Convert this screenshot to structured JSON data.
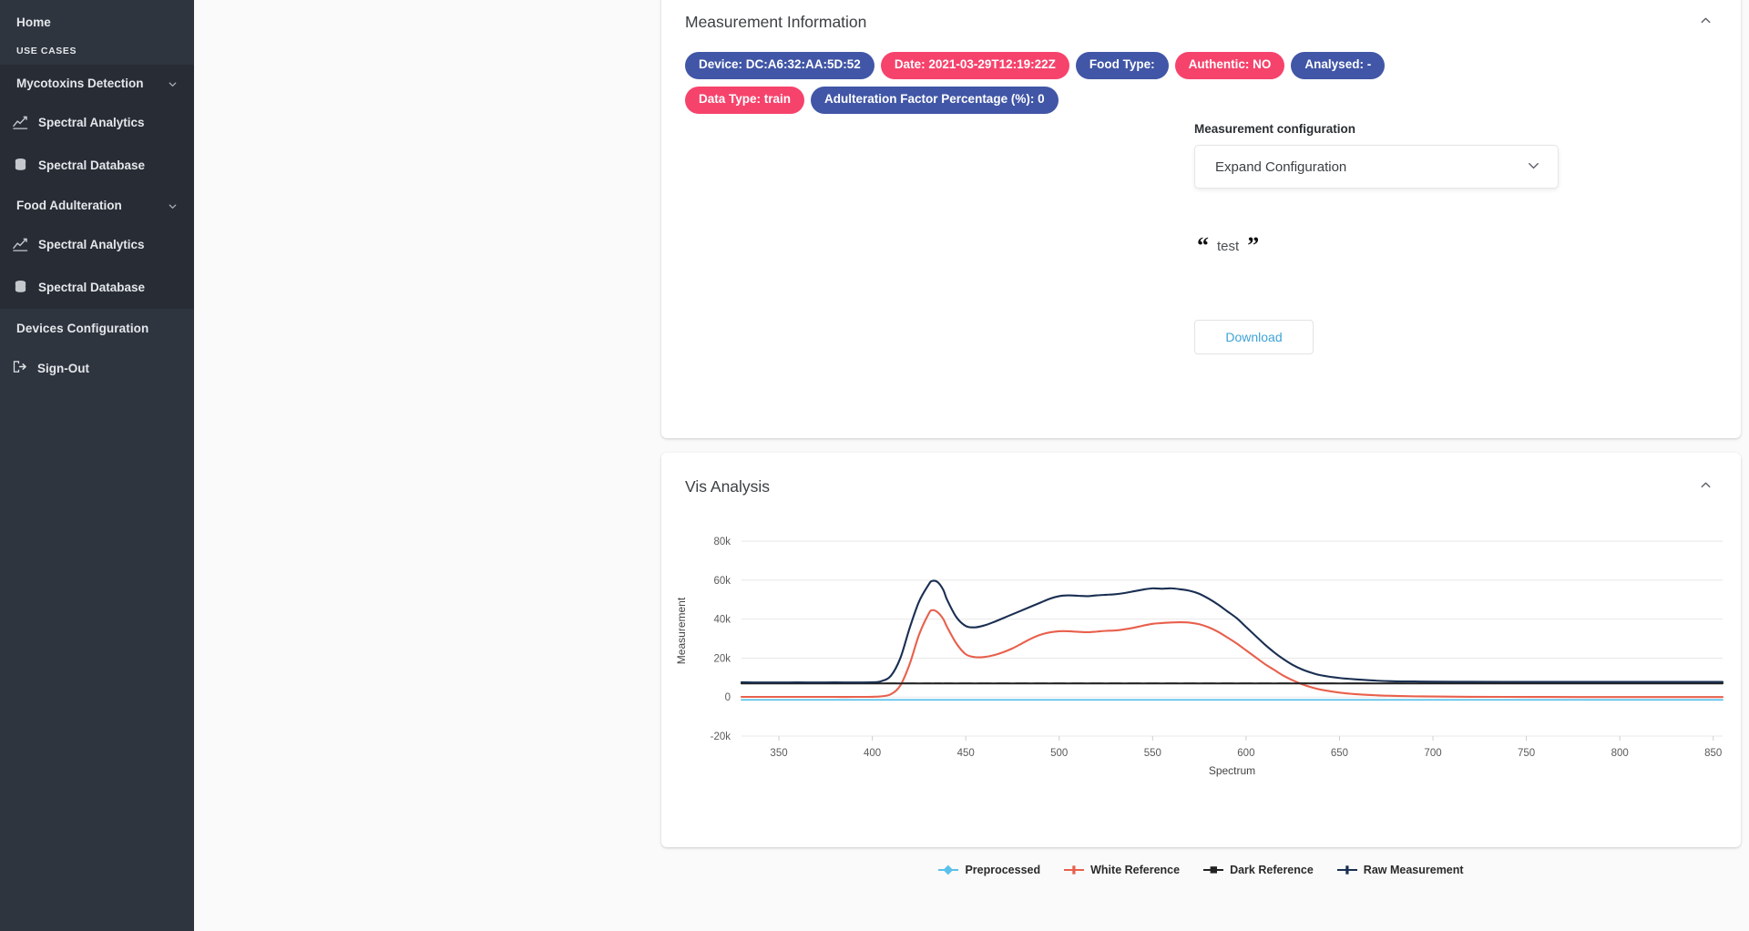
{
  "sidebar": {
    "home_label": "Home",
    "section_caption": "USE CASES",
    "groups": [
      {
        "label": "Mycotoxins Detection",
        "items": [
          {
            "label": "Spectral Analytics",
            "icon": "chart-line-icon"
          },
          {
            "label": "Spectral Database",
            "icon": "database-icon"
          }
        ]
      },
      {
        "label": "Food Adulteration",
        "items": [
          {
            "label": "Spectral Analytics",
            "icon": "chart-line-icon"
          },
          {
            "label": "Spectral Database",
            "icon": "database-icon"
          }
        ]
      }
    ],
    "devices_label": "Devices Configuration",
    "signout_label": "Sign-Out",
    "signout_icon": "sign-out-icon"
  },
  "measurement_card": {
    "title": "Measurement Information",
    "collapse_icon": "chevron-up-icon",
    "badges": [
      {
        "label": "Device: DC:A6:32:AA:5D:52",
        "color": "#4156a6",
        "variant": "primary"
      },
      {
        "label": "Date: 2021-03-29T12:19:22Z",
        "color": "#f6436c",
        "variant": "danger"
      },
      {
        "label": "Food Type:",
        "color": "#4156a6",
        "variant": "primary"
      },
      {
        "label": "Authentic: NO",
        "color": "#f6436c",
        "variant": "danger"
      },
      {
        "label": "Analysed: -",
        "color": "#4156a6",
        "variant": "primary"
      },
      {
        "label": "Data Type: train",
        "color": "#f6436c",
        "variant": "danger"
      },
      {
        "label": "Adulteration Factor Percentage (%): 0",
        "color": "#4156a6",
        "variant": "primary"
      }
    ],
    "config_label": "Measurement configuration",
    "config_value": "Expand Configuration",
    "config_chevron_icon": "chevron-down-icon",
    "quote_text": "test",
    "quote_open": "“",
    "quote_close": "”",
    "download_label": "Download"
  },
  "vis_card": {
    "title": "Vis Analysis",
    "collapse_icon": "chevron-up-icon"
  },
  "chart_data": {
    "type": "line",
    "title": "Vis Analysis",
    "xlabel": "Spectrum",
    "ylabel": "Measurement",
    "xlim": [
      330,
      855
    ],
    "ylim": [
      -20000,
      88000
    ],
    "xticks": [
      350,
      400,
      450,
      500,
      550,
      600,
      650,
      700,
      750,
      800,
      850
    ],
    "yticks": [
      -20000,
      0,
      20000,
      40000,
      60000,
      80000
    ],
    "ytick_labels": [
      "-20k",
      "0",
      "20k",
      "40k",
      "60k",
      "80k"
    ],
    "grid": true,
    "legend_position": "bottom",
    "x": [
      330,
      340,
      350,
      360,
      370,
      380,
      390,
      400,
      405,
      410,
      415,
      420,
      425,
      430,
      432,
      435,
      438,
      440,
      445,
      450,
      455,
      460,
      465,
      470,
      475,
      480,
      485,
      490,
      495,
      500,
      505,
      510,
      515,
      520,
      525,
      530,
      535,
      540,
      545,
      550,
      555,
      560,
      565,
      570,
      575,
      580,
      585,
      590,
      595,
      600,
      605,
      610,
      615,
      620,
      625,
      630,
      635,
      640,
      650,
      660,
      670,
      680,
      690,
      700,
      720,
      740,
      760,
      780,
      800,
      820,
      840,
      855
    ],
    "series": [
      {
        "name": "Raw Measurement",
        "color": "#1a2f52",
        "marker": "plus",
        "values": [
          7600,
          7500,
          7500,
          7550,
          7500,
          7550,
          7500,
          7600,
          8200,
          11000,
          20000,
          35500,
          49000,
          57500,
          59600,
          59000,
          55000,
          50000,
          41000,
          36500,
          35800,
          36800,
          38500,
          40500,
          42500,
          44500,
          46500,
          48500,
          50500,
          51800,
          52200,
          52000,
          51800,
          52200,
          52500,
          52800,
          53400,
          54300,
          55200,
          55800,
          55600,
          55800,
          55300,
          54500,
          53000,
          50500,
          47500,
          44000,
          40500,
          36000,
          31500,
          27000,
          23000,
          19500,
          16500,
          14200,
          12500,
          11200,
          9800,
          9000,
          8400,
          8100,
          8000,
          7900,
          7850,
          7820,
          7800,
          7790,
          7780,
          7780,
          7780,
          7780
        ]
      },
      {
        "name": "White Reference",
        "color": "#e8604c",
        "marker": "plus",
        "values": [
          100,
          100,
          100,
          100,
          100,
          100,
          100,
          150,
          400,
          1500,
          6000,
          17000,
          32000,
          42500,
          44600,
          43500,
          40000,
          36000,
          27500,
          22000,
          20500,
          20600,
          21500,
          23000,
          25000,
          27500,
          30000,
          32000,
          33200,
          33800,
          33800,
          33500,
          33300,
          33600,
          34000,
          34200,
          34800,
          35600,
          36700,
          37600,
          38000,
          38300,
          38400,
          38200,
          37400,
          35800,
          33500,
          30600,
          27500,
          24000,
          20500,
          17000,
          14000,
          11000,
          8600,
          6600,
          5000,
          3800,
          2300,
          1400,
          900,
          600,
          400,
          300,
          150,
          100,
          60,
          40,
          30,
          20,
          15,
          10
        ]
      },
      {
        "name": "Dark Reference",
        "color": "#222222",
        "marker": "square",
        "values": [
          7000,
          7050,
          7000,
          7050,
          7000,
          7050,
          7000,
          7050,
          7000,
          7050,
          7000,
          7050,
          7000,
          7050,
          7000,
          7050,
          7000,
          7050,
          7000,
          7050,
          7000,
          7050,
          7000,
          7050,
          7000,
          7050,
          7000,
          7050,
          7000,
          7050,
          7000,
          7050,
          7000,
          7050,
          7000,
          7050,
          7000,
          7050,
          7000,
          7050,
          7000,
          7050,
          7000,
          7050,
          7000,
          7050,
          7000,
          7050,
          7000,
          7050,
          7000,
          7050,
          7000,
          7050,
          7000,
          7050,
          7000,
          7050,
          7000,
          7050,
          7000,
          7050,
          7000,
          7050,
          7000,
          7050,
          7000,
          7050,
          7000,
          7050,
          7000,
          7050
        ]
      },
      {
        "name": "Preprocessed",
        "color": "#5bc0eb",
        "marker": "diamond",
        "values": [
          -1400,
          -1400,
          -1400,
          -1400,
          -1400,
          -1400,
          -1400,
          -1400,
          -1400,
          -1400,
          -1400,
          -1400,
          -1400,
          -1400,
          -1400,
          -1400,
          -1400,
          -1400,
          -1400,
          -1400,
          -1400,
          -1400,
          -1400,
          -1400,
          -1400,
          -1400,
          -1400,
          -1400,
          -1400,
          -1400,
          -1400,
          -1400,
          -1400,
          -1400,
          -1400,
          -1400,
          -1400,
          -1400,
          -1400,
          -1400,
          -1400,
          -1400,
          -1400,
          -1400,
          -1400,
          -1400,
          -1400,
          -1400,
          -1400,
          -1400,
          -1400,
          -1400,
          -1400,
          -1400,
          -1400,
          -1400,
          -1400,
          -1400,
          -1400,
          -1400,
          -1400,
          -1400,
          -1400,
          -1400,
          -1400,
          -1400,
          -1400,
          -1400,
          -1400,
          -1400,
          -1400,
          -1400
        ]
      }
    ],
    "legend": [
      "Preprocessed",
      "White Reference",
      "Dark Reference",
      "Raw Measurement"
    ]
  }
}
